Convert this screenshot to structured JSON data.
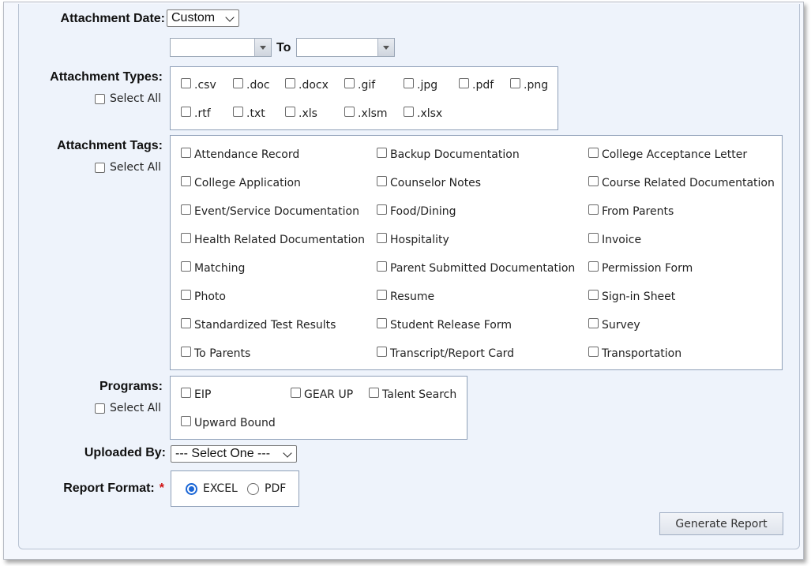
{
  "attachment_date": {
    "label": "Attachment Date:",
    "selected": "Custom",
    "to_label": "To",
    "from_value": "",
    "to_value": ""
  },
  "attachment_types": {
    "label": "Attachment Types:",
    "select_all": "Select All",
    "options": [
      ".csv",
      ".doc",
      ".docx",
      ".gif",
      ".jpg",
      ".pdf",
      ".png",
      ".rtf",
      ".txt",
      ".xls",
      ".xlsm",
      ".xlsx"
    ]
  },
  "attachment_tags": {
    "label": "Attachment Tags:",
    "select_all": "Select All",
    "options": [
      "Attendance Record",
      "Backup Documentation",
      "College Acceptance Letter",
      "College Application",
      "Counselor Notes",
      "Course Related Documentation",
      "Event/Service Documentation",
      "Food/Dining",
      "From Parents",
      "Health Related Documentation",
      "Hospitality",
      "Invoice",
      "Matching",
      "Parent Submitted Documentation",
      "Permission Form",
      "Photo",
      "Resume",
      "Sign-in Sheet",
      "Standardized Test Results",
      "Student Release Form",
      "Survey",
      "To Parents",
      "Transcript/Report Card",
      "Transportation"
    ]
  },
  "programs": {
    "label": "Programs:",
    "select_all": "Select All",
    "options": [
      "EIP",
      "GEAR UP",
      "Talent Search",
      "Upward Bound"
    ]
  },
  "uploaded_by": {
    "label": "Uploaded By:",
    "selected": "--- Select One ---"
  },
  "report_format": {
    "label": "Report Format:",
    "required_mark": "*",
    "options": [
      "EXCEL",
      "PDF"
    ],
    "selected": "EXCEL"
  },
  "generate_button": "Generate Report",
  "colors": {
    "panel_bg": "#eef3fb",
    "required": "#d01010",
    "radio_selected": "#1a66d6"
  }
}
